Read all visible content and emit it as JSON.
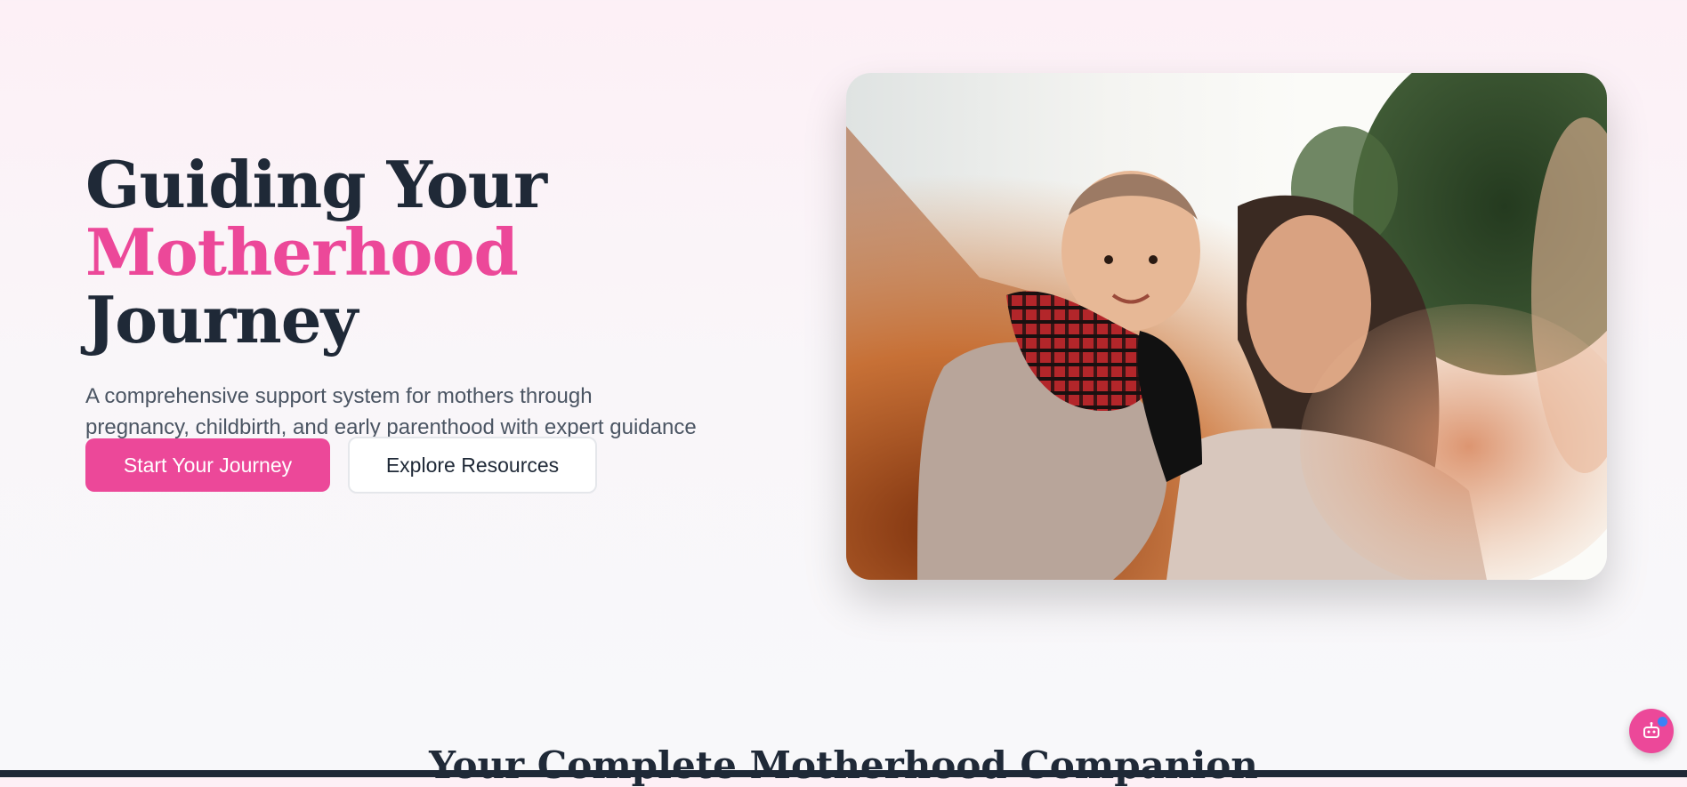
{
  "hero": {
    "headline_line1": "Guiding Your",
    "headline_accent": "Motherhood",
    "headline_rest": " Journey",
    "subtitle": "A comprehensive support system for mothers through pregnancy, childbirth, and early parenthood with expert guidance and community support.",
    "primary_button": "Start Your Journey",
    "secondary_button": "Explore Resources",
    "image_description": "mother-kissing-baby-photo"
  },
  "next_section": {
    "title": "Your Complete Motherhood Companion"
  },
  "chat_widget": {
    "icon": "chatbot-icon",
    "notification_color": "#3b82f6"
  },
  "colors": {
    "accent": "#ec4899",
    "text_dark": "#1f2937",
    "text_muted": "#4b5563"
  }
}
